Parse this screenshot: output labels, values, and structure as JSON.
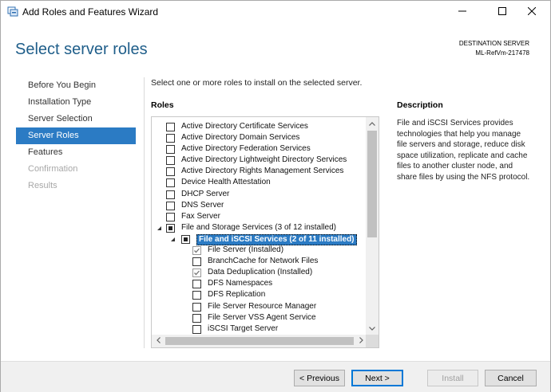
{
  "window": {
    "title": "Add Roles and Features Wizard"
  },
  "header": {
    "page_title": "Select server roles",
    "destination_label": "DESTINATION SERVER",
    "destination_name": "ML-RefVm-217478"
  },
  "nav": {
    "items": [
      {
        "label": "Before You Begin",
        "state": "normal"
      },
      {
        "label": "Installation Type",
        "state": "normal"
      },
      {
        "label": "Server Selection",
        "state": "normal"
      },
      {
        "label": "Server Roles",
        "state": "active"
      },
      {
        "label": "Features",
        "state": "normal"
      },
      {
        "label": "Confirmation",
        "state": "disabled"
      },
      {
        "label": "Results",
        "state": "disabled"
      }
    ]
  },
  "main": {
    "instruction": "Select one or more roles to install on the selected server.",
    "roles_heading": "Roles",
    "description_heading": "Description",
    "description_text": "File and iSCSI Services provides technologies that help you manage file servers and storage, reduce disk space utilization, replicate and cache files to another cluster node, and share files by using the NFS protocol."
  },
  "roles": [
    {
      "label": "Active Directory Certificate Services",
      "level": 0,
      "state": "unchecked",
      "expander": ""
    },
    {
      "label": "Active Directory Domain Services",
      "level": 0,
      "state": "unchecked",
      "expander": ""
    },
    {
      "label": "Active Directory Federation Services",
      "level": 0,
      "state": "unchecked",
      "expander": ""
    },
    {
      "label": "Active Directory Lightweight Directory Services",
      "level": 0,
      "state": "unchecked",
      "expander": ""
    },
    {
      "label": "Active Directory Rights Management Services",
      "level": 0,
      "state": "unchecked",
      "expander": ""
    },
    {
      "label": "Device Health Attestation",
      "level": 0,
      "state": "unchecked",
      "expander": ""
    },
    {
      "label": "DHCP Server",
      "level": 0,
      "state": "unchecked",
      "expander": ""
    },
    {
      "label": "DNS Server",
      "level": 0,
      "state": "unchecked",
      "expander": ""
    },
    {
      "label": "Fax Server",
      "level": 0,
      "state": "unchecked",
      "expander": ""
    },
    {
      "label": "File and Storage Services (3 of 12 installed)",
      "level": 0,
      "state": "partial",
      "expander": "expanded"
    },
    {
      "label": "File and iSCSI Services (2 of 11 installed)",
      "level": 1,
      "state": "partial",
      "expander": "expanded",
      "selected": true
    },
    {
      "label": "File Server (Installed)",
      "level": 2,
      "state": "checked",
      "expander": ""
    },
    {
      "label": "BranchCache for Network Files",
      "level": 2,
      "state": "unchecked",
      "expander": ""
    },
    {
      "label": "Data Deduplication (Installed)",
      "level": 2,
      "state": "checked",
      "expander": ""
    },
    {
      "label": "DFS Namespaces",
      "level": 2,
      "state": "unchecked",
      "expander": ""
    },
    {
      "label": "DFS Replication",
      "level": 2,
      "state": "unchecked",
      "expander": ""
    },
    {
      "label": "File Server Resource Manager",
      "level": 2,
      "state": "unchecked",
      "expander": ""
    },
    {
      "label": "File Server VSS Agent Service",
      "level": 2,
      "state": "unchecked",
      "expander": ""
    },
    {
      "label": "iSCSI Target Server",
      "level": 2,
      "state": "unchecked",
      "expander": ""
    }
  ],
  "footer": {
    "previous_label": "< Previous",
    "next_label": "Next >",
    "install_label": "Install",
    "cancel_label": "Cancel"
  },
  "colors": {
    "accent": "#2b7bc4",
    "title_blue": "#1f5e8a"
  },
  "icons": {
    "app": "server-manager-icon",
    "minimize": "minimize-icon",
    "maximize": "maximize-icon",
    "close": "close-icon"
  }
}
